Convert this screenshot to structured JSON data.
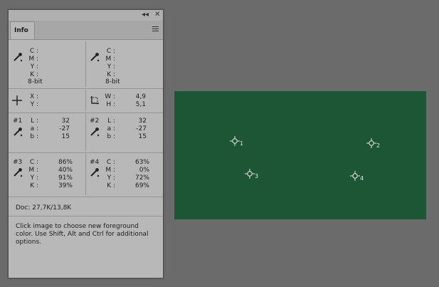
{
  "panel": {
    "tab_label": "Info",
    "collapse_icon": "collapse-double-arrow-icon",
    "close_icon": "close-icon",
    "menu_icon": "panel-menu-icon"
  },
  "color_readouts": [
    {
      "labels": [
        "C :",
        "M :",
        "Y :",
        "K :"
      ],
      "bit_depth": "8-bit"
    },
    {
      "labels": [
        "C :",
        "M :",
        "Y :",
        "K :"
      ],
      "bit_depth": "8-bit"
    }
  ],
  "position": {
    "x_label": "X :",
    "y_label": "Y :"
  },
  "size": {
    "w_label": "W :",
    "h_label": "H :",
    "w_value": "4,9",
    "h_value": "5,1"
  },
  "samplers": [
    {
      "tag": "#1",
      "labels": [
        "L :",
        "a :",
        "b :"
      ],
      "values": [
        "32",
        "-27",
        "15"
      ]
    },
    {
      "tag": "#2",
      "labels": [
        "L :",
        "a :",
        "b :"
      ],
      "values": [
        "32",
        "-27",
        "15"
      ]
    },
    {
      "tag": "#3",
      "labels": [
        "C :",
        "M :",
        "Y :",
        "K :"
      ],
      "values": [
        "86%",
        "40%",
        "91%",
        "39%"
      ]
    },
    {
      "tag": "#4",
      "labels": [
        "C :",
        "M :",
        "Y :",
        "K :"
      ],
      "values": [
        "63%",
        "0%",
        "72%",
        "69%"
      ]
    }
  ],
  "doc_info": "Doc: 27,7K/13,8K",
  "tip_lines": [
    "Click image to choose new foreground",
    "color.  Use Shift, Alt and Ctrl for additional",
    "options."
  ],
  "canvas": {
    "fill_color": "#1c5634",
    "markers": [
      {
        "label": "1"
      },
      {
        "label": "2"
      },
      {
        "label": "3"
      },
      {
        "label": "4"
      }
    ]
  }
}
